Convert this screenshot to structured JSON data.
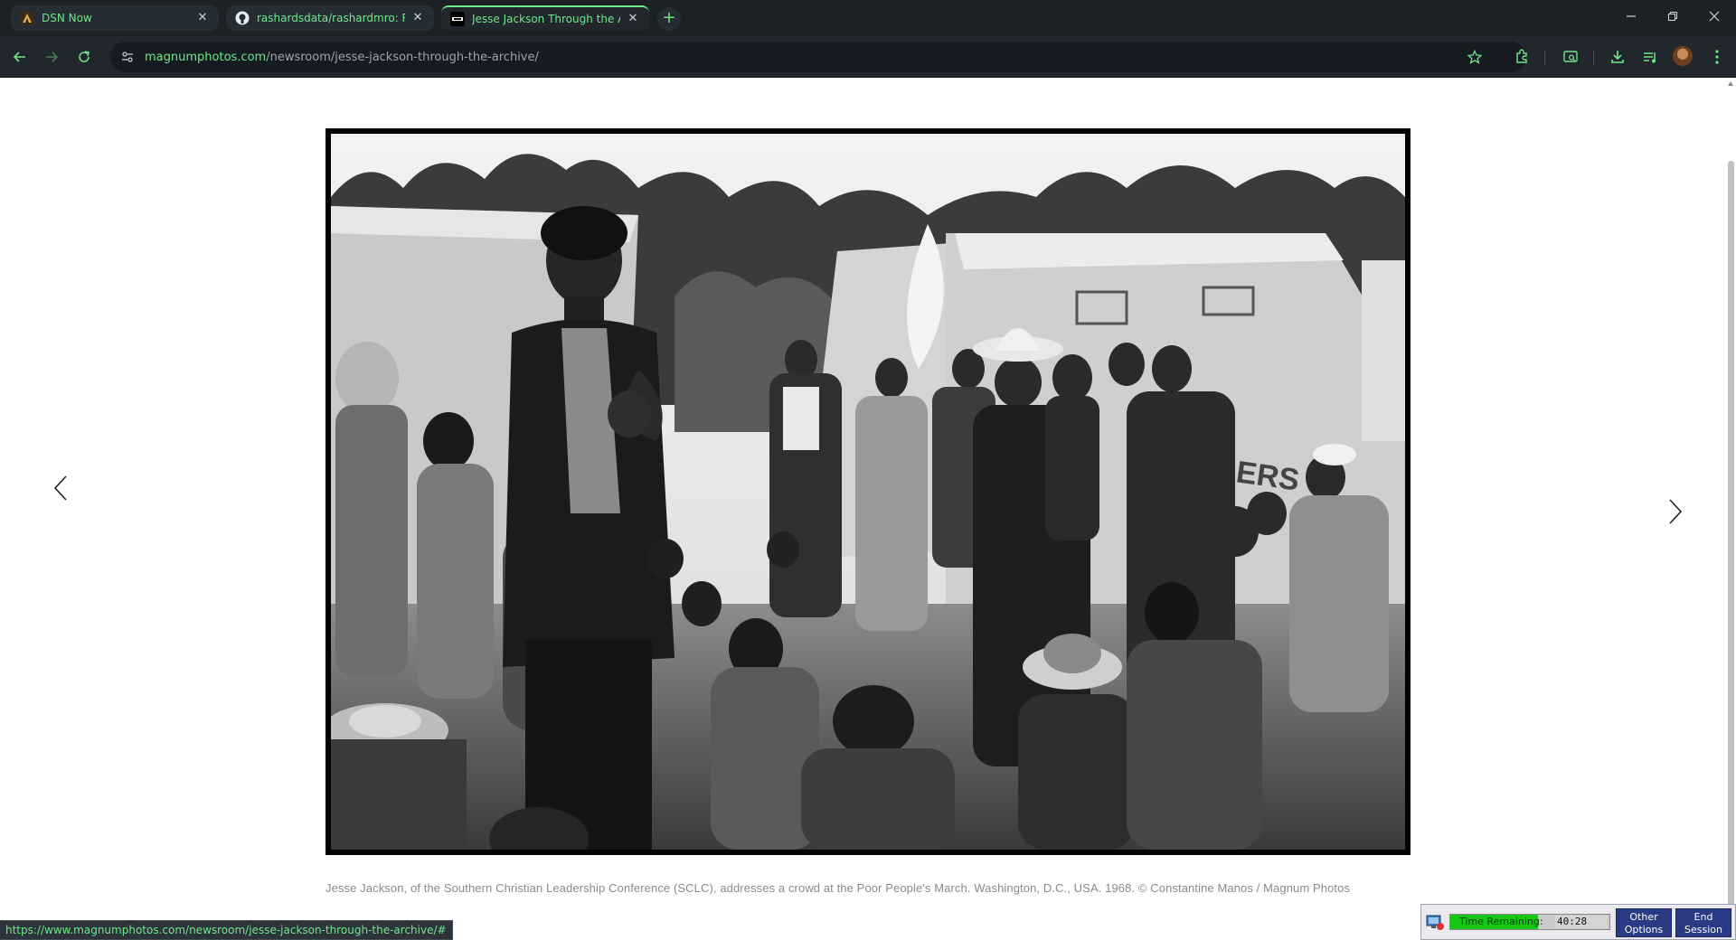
{
  "browser": {
    "tabs": [
      {
        "title": "DSN Now",
        "favicon": "dsn-favicon",
        "active": false
      },
      {
        "title": "rashardsdata/rashardmro: Rash",
        "favicon": "github-favicon",
        "active": false
      },
      {
        "title": "Jesse Jackson Through the Arch",
        "favicon": "magnum-favicon",
        "active": true
      }
    ],
    "new_tab_label": "+",
    "url_host": "magnumphotos.com",
    "url_path": "/newsroom/jesse-jackson-through-the-archive/",
    "accent_color": "#6ee787"
  },
  "page": {
    "photo_alt": "Black and white photograph of Jesse Jackson speaking to a crowd at an encampment of tents",
    "caption": "Jesse Jackson, of the Southern Christian Leadership Conference (SCLC), addresses a crowd at the Poor People's March. Washington, D.C., USA. 1968. © Constantine Manos / Magnum Photos",
    "photo_tent_text": "ERS"
  },
  "status_bar": {
    "url": "https://www.magnumphotos.com/newsroom/jesse-jackson-through-the-archive/#"
  },
  "session": {
    "time_label": "Time Remaining:",
    "time_value": "40:28",
    "time_fraction": 0.55,
    "other_options_label_1": "Other",
    "other_options_label_2": "Options",
    "end_session_label_1": "End",
    "end_session_label_2": "Session"
  }
}
